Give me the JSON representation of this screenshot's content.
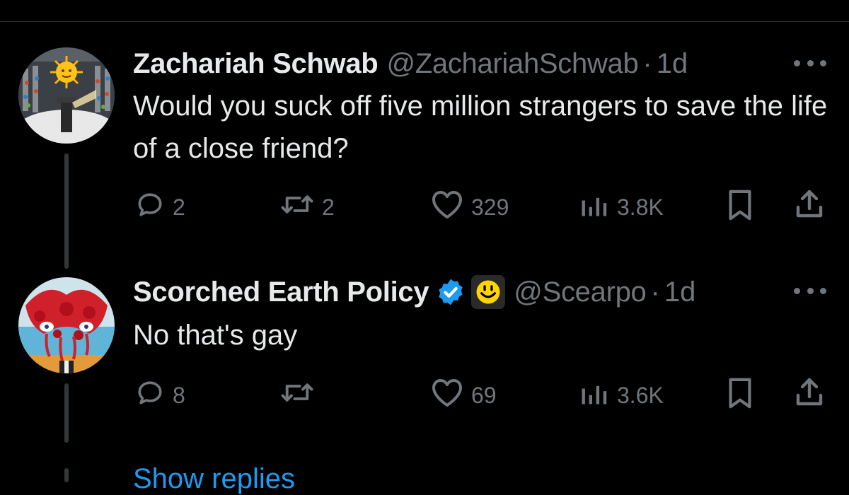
{
  "tweets": [
    {
      "name": "Zachariah Schwab",
      "handle": "@ZachariahSchwab",
      "separator": "·",
      "time": "1d",
      "text": "Would you suck off five million strangers to save the life of a close friend?",
      "actions": {
        "replies": "2",
        "reposts": "2",
        "likes": "329",
        "views": "3.8K"
      },
      "verified": false
    },
    {
      "name": "Scorched Earth Policy",
      "handle": "@Scearpo",
      "separator": "·",
      "time": "1d",
      "text": "No that's gay",
      "actions": {
        "replies": "8",
        "reposts": "",
        "likes": "69",
        "views": "3.6K"
      },
      "verified": true,
      "affiliate_badge": "smiley-face-icon"
    }
  ],
  "show_replies": "Show replies",
  "colors": {
    "background": "#000000",
    "text_primary": "#e7e9ea",
    "text_secondary": "#71767b",
    "verified_blue": "#1d9bf0",
    "link_blue": "#1d9bf0",
    "thread_line": "#333639"
  },
  "icons": {
    "reply": "reply-bubble-icon",
    "repost": "repost-arrows-icon",
    "like": "heart-icon",
    "views": "bar-chart-icon",
    "bookmark": "bookmark-icon",
    "share": "share-upload-icon",
    "more": "more-dots-icon",
    "verified": "verified-check-icon"
  }
}
